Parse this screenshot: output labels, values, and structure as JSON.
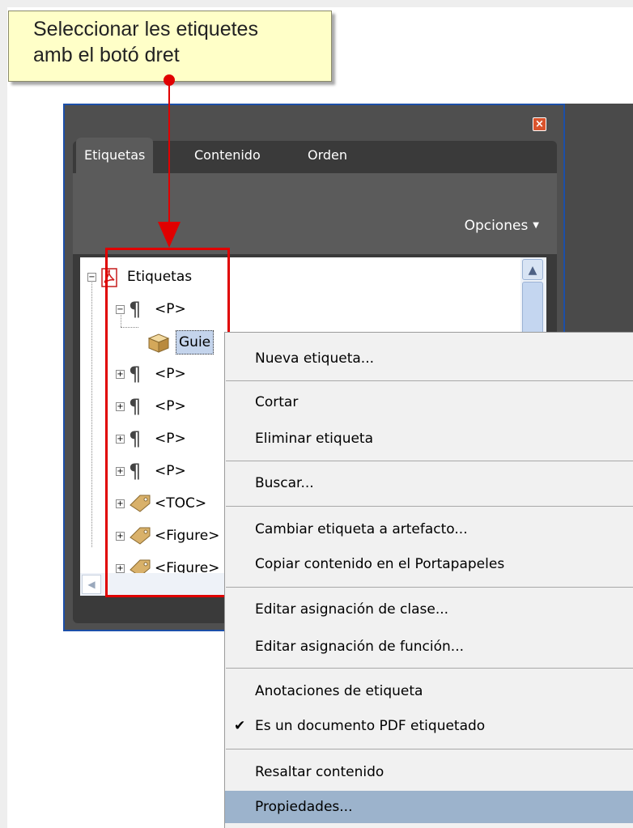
{
  "callout": {
    "line1": "Seleccionar les etiquetes",
    "line2": "amb el botó dret"
  },
  "window": {
    "close_glyph": "×",
    "tabs": [
      "Etiquetas",
      "Contenido",
      "Orden"
    ],
    "options_label": "Opciones",
    "options_caret": "▼"
  },
  "tree": {
    "root": "Etiquetas",
    "items": [
      {
        "expander": "-",
        "label": "<P>"
      },
      {
        "expander": "",
        "label": "Guie"
      },
      {
        "expander": "+",
        "label": "<P>"
      },
      {
        "expander": "+",
        "label": "<P>"
      },
      {
        "expander": "+",
        "label": "<P>"
      },
      {
        "expander": "+",
        "label": "<P>"
      },
      {
        "expander": "+",
        "label": "<TOC>"
      },
      {
        "expander": "+",
        "label": "<Figure>"
      },
      {
        "expander": "+",
        "label": "<Figure>"
      }
    ],
    "pilcrow": "¶",
    "scroll_up": "▲",
    "scroll_left": "◀"
  },
  "menu": {
    "items": [
      {
        "label": "Nueva etiqueta...",
        "accel": "N",
        "checked": false
      },
      {
        "label": "Cortar",
        "accel": "t",
        "checked": false
      },
      {
        "label": "Eliminar etiqueta",
        "accel": "l",
        "checked": false
      },
      {
        "label": "Buscar...",
        "accel": "u",
        "checked": false
      },
      {
        "label": "Cambiar etiqueta a artefacto...",
        "accel": "e",
        "checked": false
      },
      {
        "label": "Copiar contenido en el Portapapeles",
        "accel": "C",
        "checked": false
      },
      {
        "label": "Editar asignación de clase...",
        "accel": "g",
        "checked": false
      },
      {
        "label": "Editar asignación de función...",
        "accel": "d",
        "checked": false
      },
      {
        "label": "Anotaciones de etiqueta",
        "accel": "A",
        "checked": false
      },
      {
        "label": "Es un documento PDF etiquetado",
        "accel": "F",
        "checked": true
      },
      {
        "label": "Resaltar contenido",
        "accel": "R",
        "checked": false
      },
      {
        "label": "Propiedades...",
        "accel": "o",
        "checked": false
      }
    ],
    "check_glyph": "✔"
  },
  "colors": {
    "annotation_red": "#e00000",
    "highlight": "#9cb3cc",
    "window_border": "#1c4fa8"
  }
}
